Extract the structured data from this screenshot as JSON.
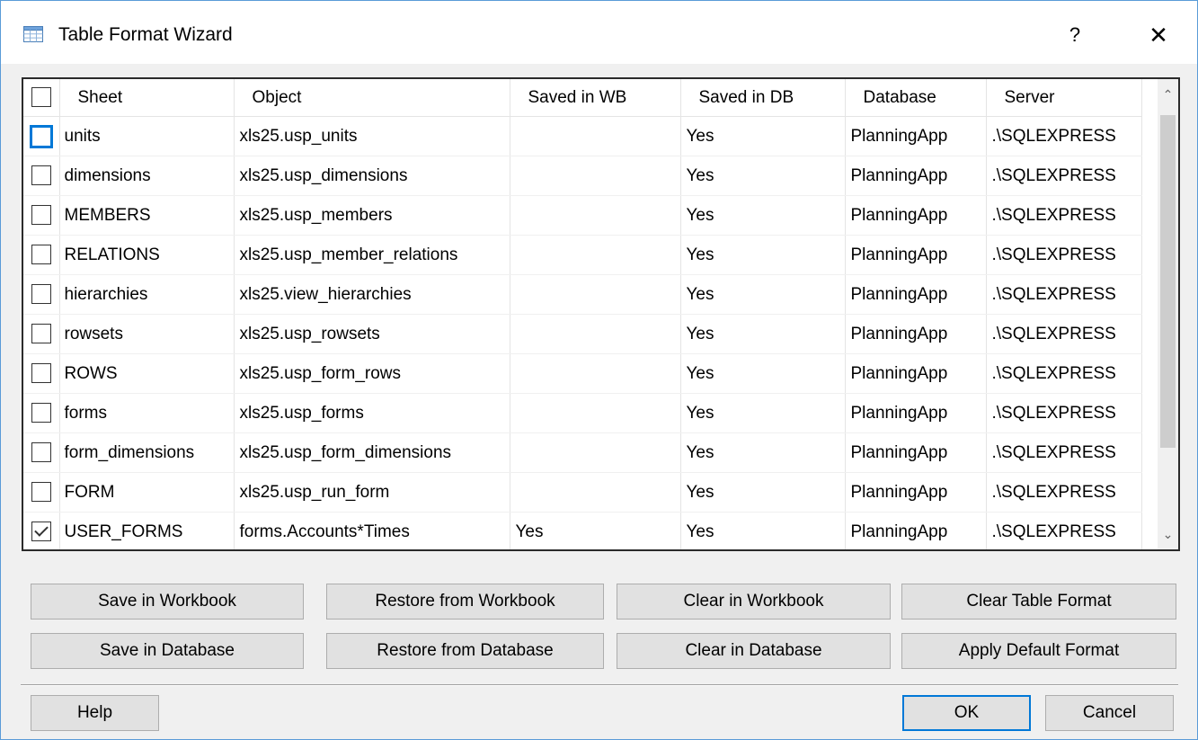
{
  "window": {
    "title": "Table Format Wizard",
    "help_label": "?",
    "close_label": "✕"
  },
  "grid": {
    "columns": [
      "Sheet",
      "Object",
      "Saved in WB",
      "Saved in DB",
      "Database",
      "Server"
    ],
    "rows": [
      {
        "checked": false,
        "sheet": "units",
        "object": "xls25.usp_units",
        "saved_wb": "",
        "saved_db": "Yes",
        "database": "PlanningApp",
        "server": ".\\SQLEXPRESS"
      },
      {
        "checked": false,
        "sheet": "dimensions",
        "object": "xls25.usp_dimensions",
        "saved_wb": "",
        "saved_db": "Yes",
        "database": "PlanningApp",
        "server": ".\\SQLEXPRESS"
      },
      {
        "checked": false,
        "sheet": "MEMBERS",
        "object": "xls25.usp_members",
        "saved_wb": "",
        "saved_db": "Yes",
        "database": "PlanningApp",
        "server": ".\\SQLEXPRESS"
      },
      {
        "checked": false,
        "sheet": "RELATIONS",
        "object": "xls25.usp_member_relations",
        "saved_wb": "",
        "saved_db": "Yes",
        "database": "PlanningApp",
        "server": ".\\SQLEXPRESS"
      },
      {
        "checked": false,
        "sheet": "hierarchies",
        "object": "xls25.view_hierarchies",
        "saved_wb": "",
        "saved_db": "Yes",
        "database": "PlanningApp",
        "server": ".\\SQLEXPRESS"
      },
      {
        "checked": false,
        "sheet": "rowsets",
        "object": "xls25.usp_rowsets",
        "saved_wb": "",
        "saved_db": "Yes",
        "database": "PlanningApp",
        "server": ".\\SQLEXPRESS"
      },
      {
        "checked": false,
        "sheet": "ROWS",
        "object": "xls25.usp_form_rows",
        "saved_wb": "",
        "saved_db": "Yes",
        "database": "PlanningApp",
        "server": ".\\SQLEXPRESS"
      },
      {
        "checked": false,
        "sheet": "forms",
        "object": "xls25.usp_forms",
        "saved_wb": "",
        "saved_db": "Yes",
        "database": "PlanningApp",
        "server": ".\\SQLEXPRESS"
      },
      {
        "checked": false,
        "sheet": "form_dimensions",
        "object": "xls25.usp_form_dimensions",
        "saved_wb": "",
        "saved_db": "Yes",
        "database": "PlanningApp",
        "server": ".\\SQLEXPRESS"
      },
      {
        "checked": false,
        "sheet": "FORM",
        "object": "xls25.usp_run_form",
        "saved_wb": "",
        "saved_db": "Yes",
        "database": "PlanningApp",
        "server": ".\\SQLEXPRESS"
      },
      {
        "checked": true,
        "sheet": "USER_FORMS",
        "object": "forms.Accounts*Times",
        "saved_wb": "Yes",
        "saved_db": "Yes",
        "database": "PlanningApp",
        "server": ".\\SQLEXPRESS"
      }
    ]
  },
  "buttons": {
    "save_wb": "Save in Workbook",
    "restore_wb": "Restore from Workbook",
    "clear_wb": "Clear in Workbook",
    "clear_format": "Clear Table Format",
    "save_db": "Save in Database",
    "restore_db": "Restore from Database",
    "clear_db": "Clear in Database",
    "apply_default": "Apply Default Format",
    "help": "Help",
    "ok": "OK",
    "cancel": "Cancel"
  },
  "icons": {
    "app": "table-icon",
    "scroll_up": "chevron-up-icon",
    "scroll_down": "chevron-down-icon"
  },
  "colors": {
    "accent": "#0078d7",
    "window_border": "#5a9bd8",
    "dialog_bg": "#f0f0f0"
  }
}
